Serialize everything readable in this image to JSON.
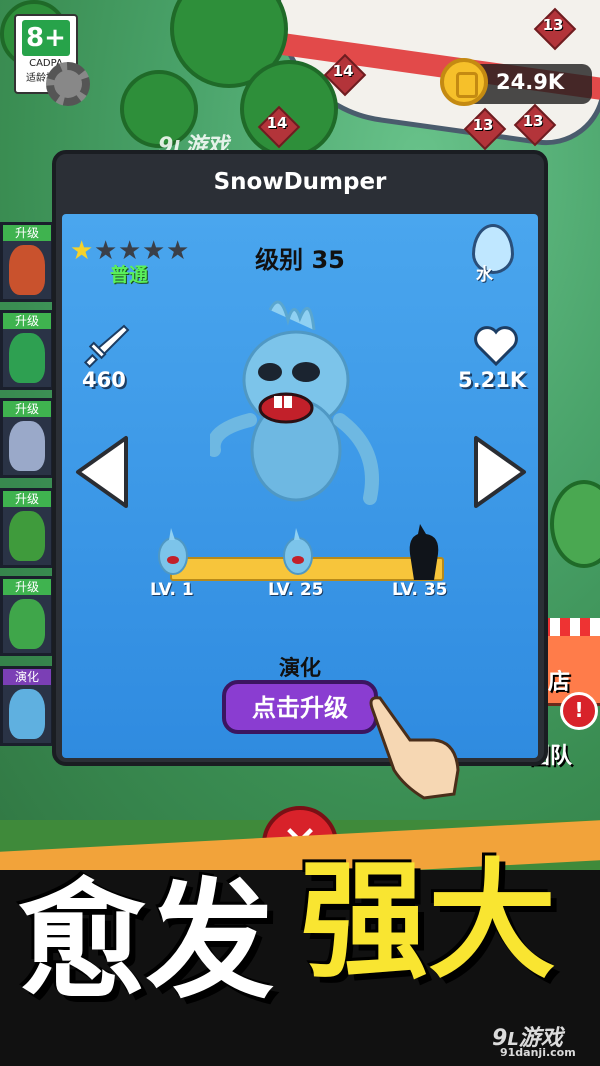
{
  "age_rating": {
    "value": "8+",
    "org": "CADPA",
    "tip": "适龄提示"
  },
  "currency": {
    "amount": "24.9K"
  },
  "watermark": {
    "brand": "游戏",
    "domain": "91danji.com"
  },
  "map_markers": [
    "13",
    "13",
    "14",
    "14",
    "13"
  ],
  "sidebar": [
    {
      "tag": "升级",
      "type": "upgrade",
      "color": "#c9522d"
    },
    {
      "tag": "升级",
      "type": "upgrade",
      "color": "#2ea051"
    },
    {
      "tag": "升级",
      "type": "upgrade",
      "color": "#9aa9c9"
    },
    {
      "tag": "升级",
      "type": "upgrade",
      "color": "#3f9b3c"
    },
    {
      "tag": "升级",
      "type": "upgrade",
      "color": "#3fa64a"
    },
    {
      "tag": "演化",
      "type": "evolve",
      "color": "#5fb0e0"
    }
  ],
  "shop": {
    "label": "店"
  },
  "team": {
    "label": "团队"
  },
  "alert": "!",
  "modal": {
    "title": "SnowDumper",
    "stars_total": 5,
    "stars_filled": 1,
    "rarity": "普通",
    "level": "级别 35",
    "element": "水",
    "attack": "460",
    "hp": "5.21K",
    "evolution": {
      "stages": [
        "LV. 1",
        "LV. 25",
        "LV. 35"
      ],
      "label": "演化"
    },
    "upgrade_button": "点击升级",
    "close_symbol": "✕"
  },
  "slogan": {
    "part1": "愈发",
    "part2": "强大"
  },
  "colors": {
    "panel": "#3b98e8",
    "button": "#8a3dd1",
    "track": "#f7c53b",
    "close": "#d8222a"
  }
}
